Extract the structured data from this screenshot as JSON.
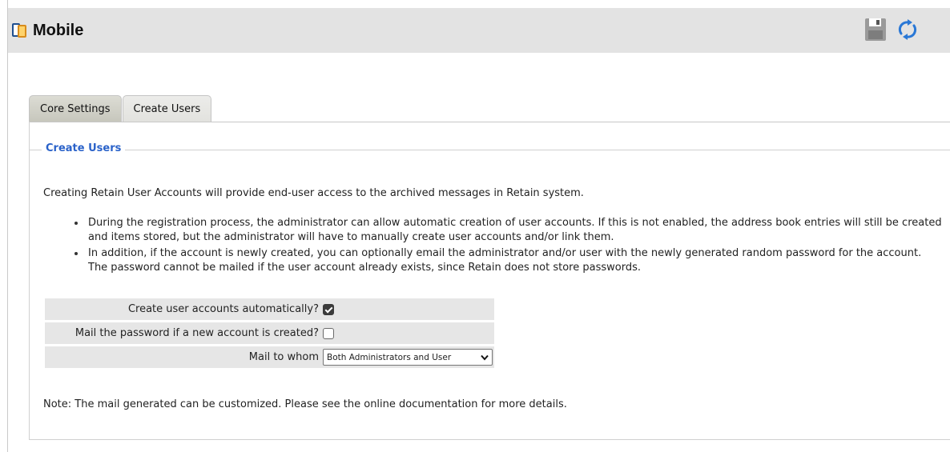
{
  "header": {
    "title": "Mobile",
    "app_icon": "mobile-devices-icon",
    "toolbar": {
      "save_icon": "floppy-disk-icon",
      "refresh_icon": "refresh-icon"
    }
  },
  "tabs": [
    {
      "label": "Core Settings",
      "active": false
    },
    {
      "label": "Create Users",
      "active": true
    }
  ],
  "section": {
    "legend": "Create Users",
    "intro": "Creating Retain User Accounts will provide end-user access to the archived messages in Retain system.",
    "bullets": [
      "During the registration process, the administrator can allow automatic creation of user accounts. If this is not enabled, the address book entries will still be created and items stored, but the administrator will have to manually create user accounts and/or link them.",
      "In addition, if the account is newly created, you can optionally email the administrator and/or user with the newly generated random password for the account. The password cannot be mailed if the user account already exists, since Retain does not store passwords."
    ]
  },
  "form": {
    "create_auto_label": "Create user accounts automatically?",
    "create_auto_checked": true,
    "mail_password_label": "Mail the password if a new account is created?",
    "mail_password_checked": false,
    "mail_to_label": "Mail to whom",
    "mail_to_value": "Both Administrators and User"
  },
  "note": "Note: The mail generated can be customized. Please see the online documentation for more details.",
  "colors": {
    "legend": "#2a62c9",
    "refresh_icon": "#2a78d6",
    "header_bg": "#e3e3e3"
  }
}
